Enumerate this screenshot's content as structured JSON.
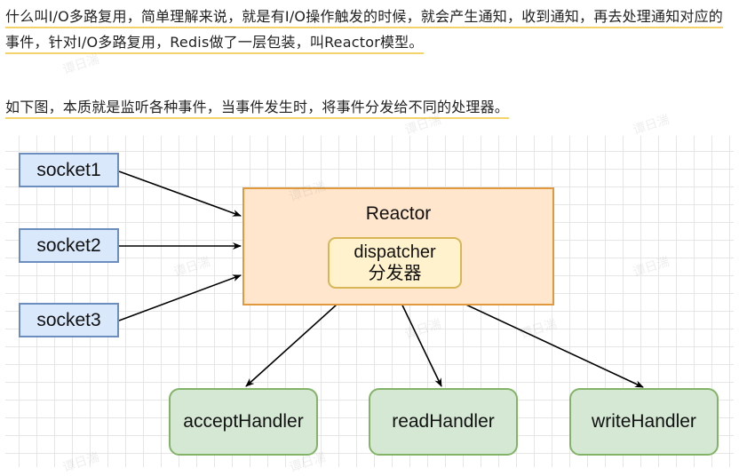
{
  "paragraphs": {
    "p1": "什么叫I/O多路复用，简单理解来说，就是有I/O操作触发的时候，就会产生通知，收到通知，再去处理通知对应的事件，针对I/O多路复用，Redis做了一层包装，叫Reactor模型。",
    "p2": "如下图，本质就是监听各种事件，当事件发生时，将事件分发给不同的处理器。"
  },
  "diagram": {
    "sockets": [
      "socket1",
      "socket2",
      "socket3"
    ],
    "reactor_label": "Reactor",
    "dispatcher_line1": "dispatcher",
    "dispatcher_line2": "分发器",
    "handlers": [
      "acceptHandler",
      "readHandler",
      "writeHandler"
    ]
  },
  "watermark": "谭日湍",
  "colors": {
    "socket_fill": "#dae8fc",
    "socket_stroke": "#6c8ebf",
    "reactor_fill": "#ffe6cc",
    "reactor_stroke": "#e09a3d",
    "dispatcher_fill": "#fff2cc",
    "dispatcher_stroke": "#d6b656",
    "handler_fill": "#d5e8d4",
    "handler_stroke": "#82b366",
    "highlight_underline": "#f3d36a"
  }
}
